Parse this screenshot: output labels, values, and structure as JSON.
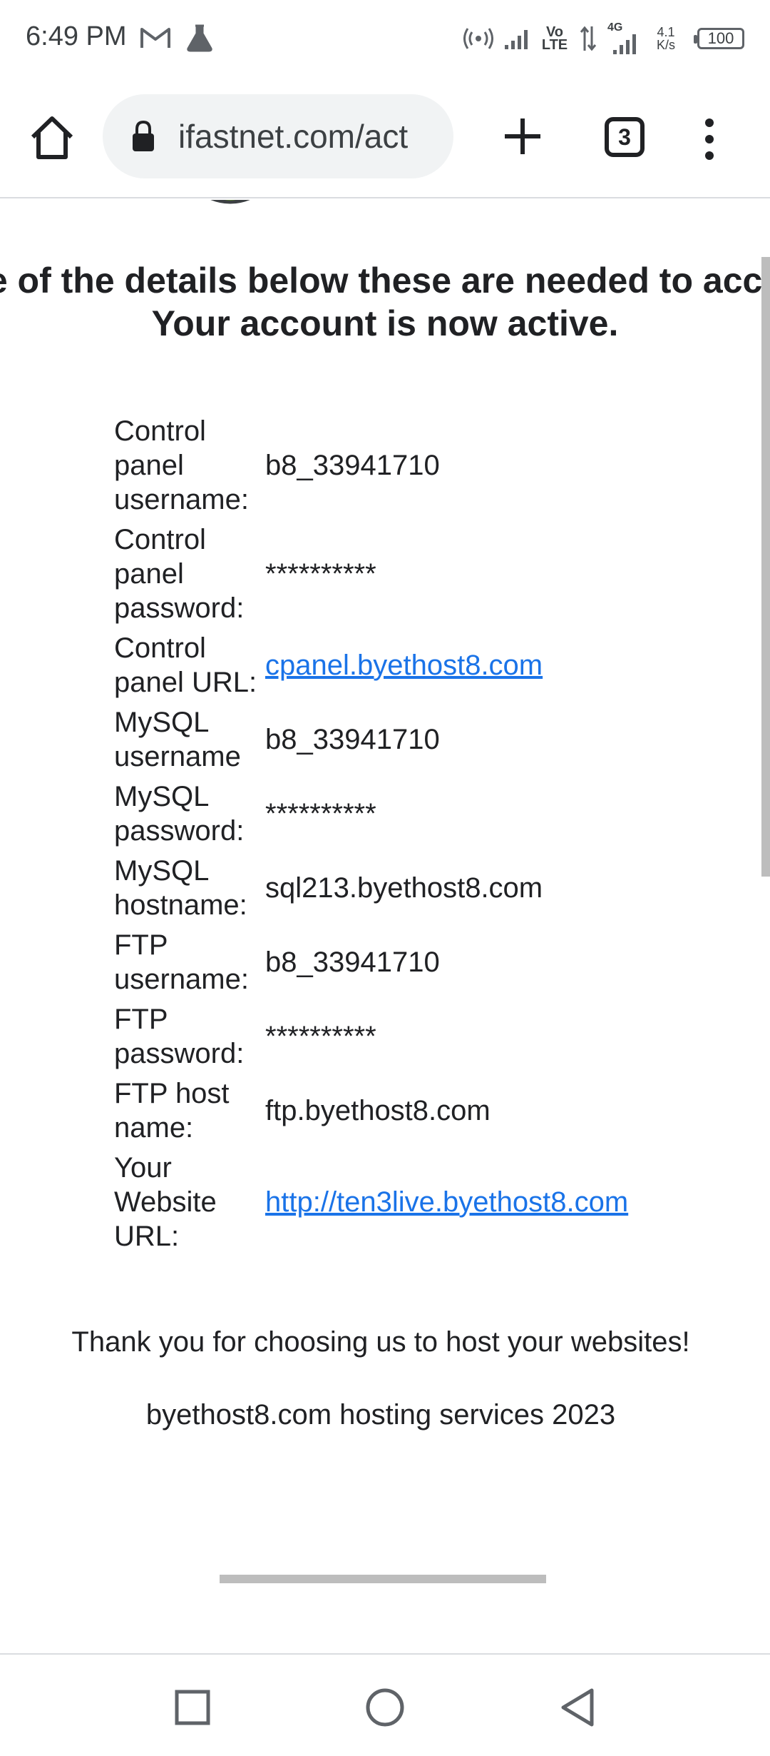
{
  "status_bar": {
    "time": "6:49 PM",
    "network_speed_value": "4.1",
    "network_speed_unit": "K/s",
    "network_type": "4G",
    "volte_top": "Vo",
    "volte_bottom": "LTE",
    "battery": "100",
    "icons": [
      "gmail-icon",
      "lab-flask-icon",
      "hotspot-icon",
      "signal-icon",
      "volte-icon",
      "data-arrows-icon",
      "signal-4g-icon",
      "battery-icon"
    ]
  },
  "browser": {
    "url": "ifastnet.com/act",
    "tab_count": "3",
    "icons": [
      "home-icon",
      "lock-icon",
      "plus-icon",
      "tab-switcher-icon",
      "more-vert-icon"
    ]
  },
  "page": {
    "notice": "e of the details below these are needed to acce",
    "status": "Your account is now active.",
    "details": [
      {
        "label": "Control panel username:",
        "value": "b8_33941710",
        "link": false
      },
      {
        "label": "Control panel password:",
        "value": "**********",
        "link": false
      },
      {
        "label": "Control panel URL:",
        "value": "cpanel.byethost8.com",
        "link": true
      },
      {
        "label": "MySQL username",
        "value": "b8_33941710",
        "link": false
      },
      {
        "label": "MySQL password:",
        "value": "**********",
        "link": false
      },
      {
        "label": "MySQL hostname:",
        "value": "sql213.byethost8.com",
        "link": false
      },
      {
        "label": "FTP username:",
        "value": "b8_33941710",
        "link": false
      },
      {
        "label": "FTP password:",
        "value": "**********",
        "link": false
      },
      {
        "label": "FTP host name:",
        "value": "ftp.byethost8.com",
        "link": false
      },
      {
        "label": "Your Website URL:",
        "value": "http://ten3live.byethost8.com",
        "link": true
      }
    ],
    "thanks": "Thank you for choosing us to host your websites!",
    "footer": "byethost8.com hosting services 2023"
  },
  "nav_bar": {
    "icons": [
      "recents-square-icon",
      "home-circle-icon",
      "back-triangle-icon"
    ]
  },
  "colors": {
    "link": "#1a73e8",
    "omnibox_bg": "#f1f3f4",
    "text": "#202124"
  }
}
